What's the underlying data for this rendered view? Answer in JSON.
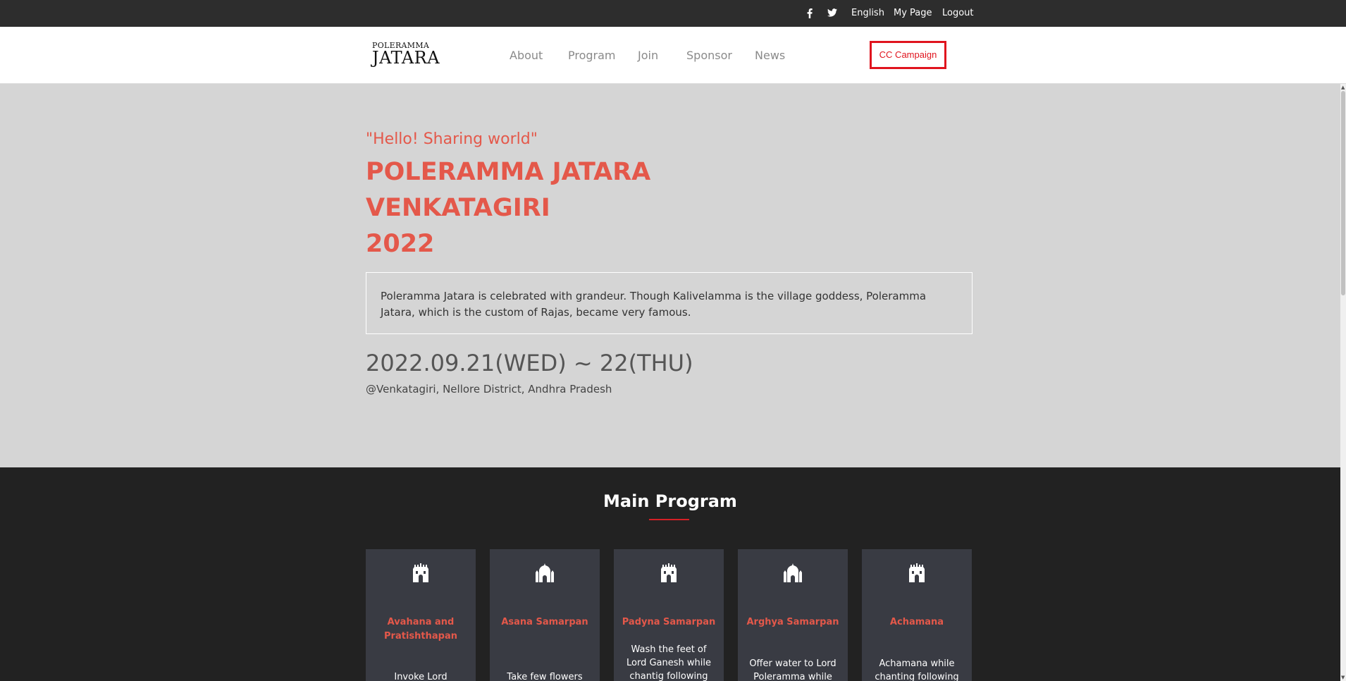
{
  "topbar": {
    "facebook_icon": "facebook-icon",
    "twitter_icon": "twitter-icon",
    "language": "English",
    "mypage": "My Page",
    "logout": "Logout"
  },
  "nav": {
    "logo_small": "POLERAMMA",
    "logo_big": "JATARA",
    "links": [
      "About",
      "Program",
      "Join",
      "Sponsor",
      "News"
    ],
    "cta": "CC Campaign"
  },
  "hero": {
    "tagline": "\"Hello! Sharing world\"",
    "title_lines": [
      "POLERAMMA JATARA",
      "VENKATAGIRI",
      "2022"
    ],
    "description": "Poleramma Jatara is celebrated with grandeur. Though Kalivelamma is the village goddess, Poleramma Jatara, which is the custom of Rajas, became very famous.",
    "date": "2022.09.21(WED) ~ 22(THU)",
    "location": "@Venkatagiri, Nellore District, Andhra Pradesh"
  },
  "program": {
    "heading": "Main Program",
    "cards": [
      {
        "icon": "temple-icon",
        "name": "Avahana and Pratishthapan",
        "text": "Invoke Lord"
      },
      {
        "icon": "mosque-icon",
        "name": "Asana Samarpan",
        "text": "Take few flowers"
      },
      {
        "icon": "temple-icon",
        "name": "Padyna Samarpan",
        "text": "Wash the feet of Lord Ganesh while chantig following"
      },
      {
        "icon": "mosque-icon",
        "name": "Arghya Samarpan",
        "text": "Offer water to Lord Poleramma while"
      },
      {
        "icon": "temple-icon",
        "name": "Achamana",
        "text": "Achamana while chanting following"
      }
    ]
  },
  "colors": {
    "accent": "#e4584a",
    "cta_red": "#e0141e",
    "topbar_bg": "#2d2d2d",
    "hero_bg": "#d5d5d5",
    "program_bg": "#222222",
    "card_bg": "#393b43"
  }
}
